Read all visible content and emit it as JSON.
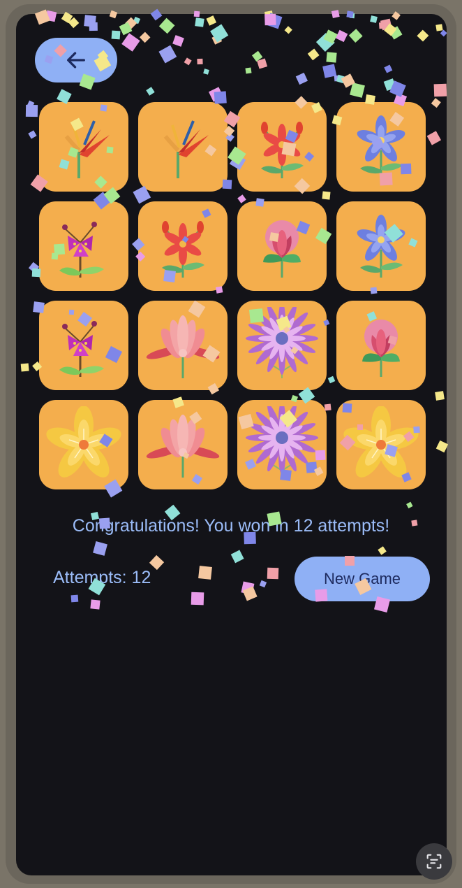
{
  "header": {
    "back_icon": "arrow-left-icon"
  },
  "colors": {
    "card": "#f4ae4d",
    "accent": "#8fb0f5",
    "text_accent": "#9bbcf8",
    "background": "#131318"
  },
  "cards": [
    {
      "flower": "bird-of-paradise"
    },
    {
      "flower": "bird-of-paradise"
    },
    {
      "flower": "red-lily"
    },
    {
      "flower": "blue-bellflower"
    },
    {
      "flower": "magenta-bougainvillea"
    },
    {
      "flower": "red-lily"
    },
    {
      "flower": "pink-tulip-bud"
    },
    {
      "flower": "blue-bellflower"
    },
    {
      "flower": "magenta-bougainvillea"
    },
    {
      "flower": "pink-lotus"
    },
    {
      "flower": "purple-daisy"
    },
    {
      "flower": "pink-tulip-bud"
    },
    {
      "flower": "yellow-star-flower"
    },
    {
      "flower": "pink-lotus"
    },
    {
      "flower": "purple-daisy"
    },
    {
      "flower": "yellow-star-flower"
    }
  ],
  "status": {
    "message": "Congratulations! You won in 12 attempts!",
    "attempts_label": "Attempts: 12",
    "attempts": 12
  },
  "controls": {
    "new_game_label": "New Game",
    "scan_icon": "screen-scan-icon"
  }
}
